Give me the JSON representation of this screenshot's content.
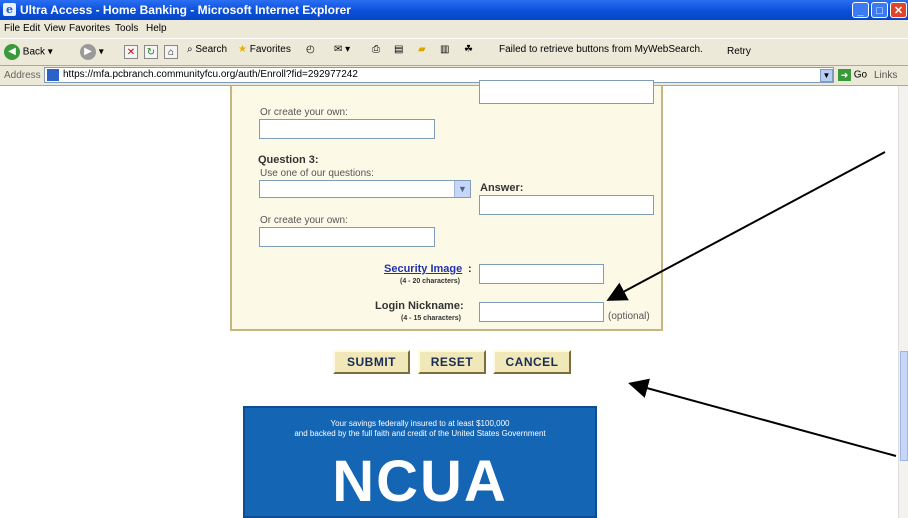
{
  "window": {
    "title": "Ultra Access - Home Banking - Microsoft Internet Explorer",
    "icon": "ie-icon",
    "controls": [
      "minimize",
      "maximize",
      "close"
    ]
  },
  "menu": [
    "File",
    "Edit",
    "View",
    "Favorites",
    "Tools",
    "Help"
  ],
  "toolbar": {
    "back_label": "Back",
    "search_label": "Search",
    "favorites_label": "Favorites",
    "status_message": "Failed to retrieve buttons from MyWebSearch.",
    "retry_label": "Retry"
  },
  "address": {
    "label": "Address",
    "url": "https://mfa.pcbranch.communityfcu.org/auth/Enroll?fid=292977242",
    "go_label": "Go",
    "links_label": "Links"
  },
  "form": {
    "create_own_label_1": "Or create your own:",
    "question3_label": "Question 3:",
    "use_ours_label": "Use one of our questions:",
    "answer_label": "Answer:",
    "create_own_label_2": "Or create your own:",
    "security_image_label": "Security Image",
    "security_image_colon": ":",
    "security_image_hint": "(4 - 20 characters)",
    "nickname_label": "Login Nickname:",
    "nickname_hint": "(4 - 15 characters)",
    "optional_label": "(optional)"
  },
  "buttons": {
    "submit": "SUBMIT",
    "reset": "RESET",
    "cancel": "CANCEL"
  },
  "ncua": {
    "line1": "Your savings federally insured to at least $100,000",
    "line2": "and backed by the full faith and credit of the United States Government",
    "logo_text": "NCUA"
  },
  "colors": {
    "titlebar": "#0a4fd8",
    "panel_bg": "#fcf9e6",
    "button_bg": "#f0e8b8",
    "ncua_blue": "#1565b5"
  }
}
